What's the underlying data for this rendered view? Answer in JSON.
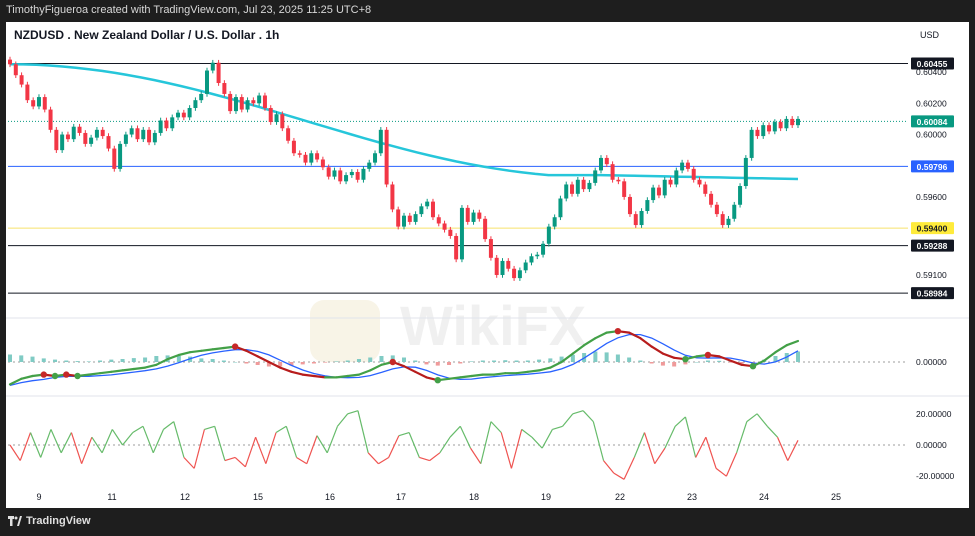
{
  "header": {
    "credit": "TimothyFigueroa created with TradingView.com, Jul 23, 2025 11:25 UTC+8",
    "symbol_title": "NZDUSD . New Zealand Dollar / U.S. Dollar . 1h",
    "currency": "USD"
  },
  "footer": {
    "brand": "TradingView"
  },
  "watermark": "WikiFX",
  "chart_data": {
    "type": "candlestick",
    "x_ticks": [
      "9",
      "11",
      "12",
      "15",
      "16",
      "17",
      "18",
      "19",
      "22",
      "23",
      "24",
      "25"
    ],
    "price_ticks": [
      "0.60400",
      "0.60200",
      "0.60000",
      "0.59600",
      "0.59100"
    ],
    "price_ylim": [
      0.5885,
      0.6058
    ],
    "candles_close": [
      0.6045,
      0.6038,
      0.6032,
      0.6022,
      0.6018,
      0.6024,
      0.6016,
      0.6003,
      0.599,
      0.6,
      0.5997,
      0.6005,
      0.6001,
      0.5994,
      0.5998,
      0.6003,
      0.5999,
      0.5991,
      0.5978,
      0.5994,
      0.6,
      0.6004,
      0.5997,
      0.6003,
      0.5995,
      0.6001,
      0.6009,
      0.6004,
      0.6011,
      0.6014,
      0.6011,
      0.6017,
      0.6022,
      0.6026,
      0.6041,
      0.6046,
      0.6033,
      0.6026,
      0.6015,
      0.6024,
      0.6016,
      0.6022,
      0.602,
      0.6025,
      0.6017,
      0.6008,
      0.6013,
      0.6004,
      0.5996,
      0.5988,
      0.5987,
      0.5982,
      0.5988,
      0.5984,
      0.5979,
      0.5973,
      0.5977,
      0.597,
      0.5974,
      0.5976,
      0.5971,
      0.5978,
      0.5982,
      0.5988,
      0.6003,
      0.5968,
      0.5952,
      0.5941,
      0.5948,
      0.5944,
      0.5949,
      0.5954,
      0.5957,
      0.5947,
      0.5943,
      0.5939,
      0.5935,
      0.592,
      0.5953,
      0.5944,
      0.595,
      0.5946,
      0.5933,
      0.5921,
      0.591,
      0.5919,
      0.5914,
      0.5908,
      0.5913,
      0.5918,
      0.5922,
      0.5923,
      0.593,
      0.5941,
      0.5947,
      0.5959,
      0.5968,
      0.5962,
      0.5971,
      0.5965,
      0.5969,
      0.5977,
      0.5985,
      0.5981,
      0.5971,
      0.597,
      0.596,
      0.5949,
      0.5942,
      0.5951,
      0.5958,
      0.5966,
      0.5961,
      0.5971,
      0.5968,
      0.5977,
      0.5982,
      0.5978,
      0.5971,
      0.5968,
      0.5962,
      0.5955,
      0.5949,
      0.5942,
      0.5946,
      0.5955,
      0.5967,
      0.5985,
      0.6003,
      0.5999,
      0.6006,
      0.6002,
      0.6008,
      0.6004,
      0.601,
      0.6006,
      0.601
    ],
    "ema_line": {
      "start": 0.6045,
      "end": 0.5974
    },
    "horizontal_lines": [
      {
        "price": 0.60455,
        "label": "0.60455",
        "color": "#131722",
        "label_bg": "#131722",
        "label_fg": "#ffffff"
      },
      {
        "price": 0.60084,
        "label": "0.60084",
        "color": "#089981",
        "label_bg": "#089981",
        "label_fg": "#ffffff",
        "dotted": true
      },
      {
        "price": 0.59796,
        "label": "0.59796",
        "color": "#2962ff",
        "label_bg": "#2962ff",
        "label_fg": "#ffffff"
      },
      {
        "price": 0.594,
        "label": "0.59400",
        "color": "#f7e26b",
        "label_bg": "#ffeb3b",
        "label_fg": "#131722"
      },
      {
        "price": 0.59288,
        "label": "0.59288",
        "color": "#131722",
        "label_bg": "#131722",
        "label_fg": "#ffffff"
      },
      {
        "price": 0.58984,
        "label": "0.58984",
        "color": "#131722",
        "label_bg": "#131722",
        "label_fg": "#ffffff"
      }
    ],
    "macd": {
      "zero_label": "0.00000",
      "macd_values": [
        -0.8,
        -0.6,
        -0.5,
        -0.45,
        -0.5,
        -0.45,
        -0.5,
        -0.45,
        -0.4,
        -0.35,
        -0.3,
        -0.25,
        -0.2,
        -0.1,
        0.1,
        0.25,
        0.35,
        0.4,
        0.45,
        0.5,
        0.55,
        0.4,
        0.2,
        0.0,
        -0.2,
        -0.35,
        -0.45,
        -0.5,
        -0.55,
        -0.55,
        -0.5,
        -0.45,
        -0.3,
        -0.1,
        0.0,
        -0.15,
        -0.35,
        -0.55,
        -0.65,
        -0.6,
        -0.55,
        -0.5,
        -0.45,
        -0.45,
        -0.4,
        -0.4,
        -0.35,
        -0.3,
        -0.2,
        0.0,
        0.3,
        0.6,
        0.85,
        1.05,
        1.1,
        1.05,
        0.85,
        0.55,
        0.3,
        0.15,
        0.1,
        0.2,
        0.25,
        0.2,
        0.05,
        -0.1,
        -0.15,
        0.05,
        0.35,
        0.6,
        0.75
      ],
      "hist_values": [
        0.25,
        0.22,
        0.18,
        0.12,
        0.08,
        0.05,
        0.03,
        0.02,
        0.05,
        0.08,
        0.1,
        0.13,
        0.15,
        0.2,
        0.22,
        0.2,
        0.18,
        0.12,
        0.1,
        0.05,
        0.0,
        -0.05,
        -0.1,
        -0.15,
        -0.15,
        -0.12,
        -0.08,
        -0.05,
        -0.02,
        0.02,
        0.05,
        0.1,
        0.15,
        0.2,
        0.22,
        0.15,
        0.05,
        -0.08,
        -0.12,
        -0.1,
        -0.05,
        0.02,
        0.05,
        0.05,
        0.06,
        0.05,
        0.05,
        0.08,
        0.12,
        0.18,
        0.24,
        0.3,
        0.35,
        0.32,
        0.25,
        0.15,
        0.05,
        -0.05,
        -0.12,
        -0.15,
        -0.08,
        0.0,
        0.05,
        0.04,
        -0.02,
        -0.06,
        -0.08,
        0.08,
        0.2,
        0.3,
        0.35
      ]
    },
    "oscillator": {
      "tick_labels": [
        "20.00000",
        "0.00000",
        "-20.00000"
      ],
      "ylim": [
        -25,
        25
      ],
      "values": [
        0,
        -10,
        8,
        -8,
        10,
        -5,
        8,
        -12,
        5,
        -5,
        10,
        0,
        8,
        12,
        -5,
        10,
        15,
        -8,
        -15,
        10,
        12,
        -10,
        -8,
        -14,
        5,
        -12,
        8,
        12,
        -8,
        -12,
        6,
        -5,
        12,
        20,
        22,
        -5,
        -12,
        -8,
        6,
        8,
        -8,
        -10,
        -5,
        5,
        12,
        -2,
        -12,
        15,
        8,
        -15,
        10,
        5,
        -2,
        10,
        12,
        20,
        22,
        15,
        -10,
        -18,
        -22,
        -8,
        8,
        -12,
        -2,
        12,
        18,
        -8,
        5,
        -15,
        -20,
        -5,
        15,
        20,
        12,
        5,
        -10,
        3
      ]
    }
  }
}
